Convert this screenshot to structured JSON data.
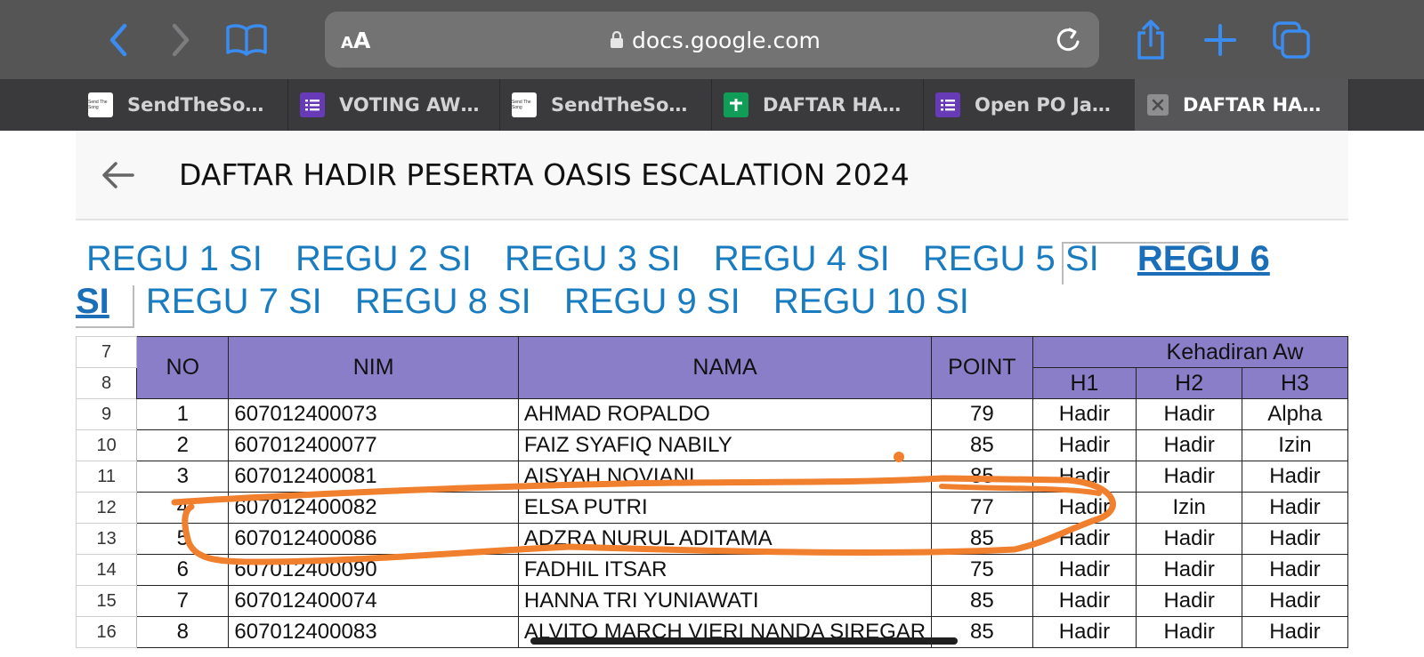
{
  "browser": {
    "url_display": "docs.google.com",
    "text_size_small": "A",
    "text_size_big": "A",
    "tabs": [
      {
        "label": "SendTheSo…",
        "favicon": "sendthesong-favicon",
        "active": false
      },
      {
        "label": "VOTING AW…",
        "favicon": "google-forms-icon",
        "active": false
      },
      {
        "label": "SendTheSo…",
        "favicon": "sendthesong-favicon",
        "active": false
      },
      {
        "label": "DAFTAR HA…",
        "favicon": "google-sheets-icon",
        "active": false
      },
      {
        "label": "Open PO Ja…",
        "favicon": "google-forms-icon",
        "active": false
      },
      {
        "label": "DAFTAR HA…",
        "favicon": "close-tab-icon",
        "active": true
      }
    ],
    "favicon_text": "Send The Song",
    "colors": {
      "accent": "#3b82f6",
      "forms": "#673ab7",
      "sheets": "#0f9d58"
    }
  },
  "doc": {
    "title": "DAFTAR HADIR PESERTA OASIS ESCALATION 2024",
    "sheet_tabs": [
      "REGU 1 SI",
      "REGU 2 SI",
      "REGU 3 SI",
      "REGU 4 SI",
      "REGU 5 SI",
      "REGU 6 SI",
      "REGU 7 SI",
      "REGU 8 SI",
      "REGU 9 SI",
      "REGU 10 SI"
    ],
    "active_tab": "REGU 6 SI",
    "active_tab_part1": "REGU 6",
    "active_tab_part2": "SI"
  },
  "sheet": {
    "header_color": "#8b7ec8",
    "row_numbers": [
      "7",
      "8",
      "9",
      "10",
      "11",
      "12",
      "13",
      "14",
      "15",
      "16"
    ],
    "headers": {
      "no": "NO",
      "nim": "NIM",
      "nama": "NAMA",
      "point": "POINT",
      "kehadiran": "Kehadiran Aw",
      "h1": "H1",
      "h2": "H2",
      "h3": "H3"
    },
    "rows": [
      {
        "row": "9",
        "no": "1",
        "nim": "607012400073",
        "nama": "AHMAD ROPALDO",
        "point": "79",
        "h1": "Hadir",
        "h2": "Hadir",
        "h3": "Alpha"
      },
      {
        "row": "10",
        "no": "2",
        "nim": "607012400077",
        "nama": "FAIZ SYAFIQ NABILY",
        "point": "85",
        "h1": "Hadir",
        "h2": "Hadir",
        "h3": "Izin"
      },
      {
        "row": "11",
        "no": "3",
        "nim": "607012400081",
        "nama": "AISYAH NOVIANI",
        "point": "85",
        "h1": "Hadir",
        "h2": "Hadir",
        "h3": "Hadir"
      },
      {
        "row": "12",
        "no": "4",
        "nim": "607012400082",
        "nama": "ELSA PUTRI",
        "point": "77",
        "h1": "Hadir",
        "h2": "Izin",
        "h3": "Hadir"
      },
      {
        "row": "13",
        "no": "5",
        "nim": "607012400086",
        "nama": "ADZRA NURUL ADITAMA",
        "point": "85",
        "h1": "Hadir",
        "h2": "Hadir",
        "h3": "Hadir"
      },
      {
        "row": "14",
        "no": "6",
        "nim": "607012400090",
        "nama": "FADHIL ITSAR",
        "point": "75",
        "h1": "Hadir",
        "h2": "Hadir",
        "h3": "Hadir"
      },
      {
        "row": "15",
        "no": "7",
        "nim": "607012400074",
        "nama": "HANNA TRI YUNIAWATI",
        "point": "85",
        "h1": "Hadir",
        "h2": "Hadir",
        "h3": "Hadir"
      },
      {
        "row": "16",
        "no": "8",
        "nim": "607012400083",
        "nama": "ALVITO MARCH VIERI NANDA SIREGAR",
        "point": "85",
        "h1": "Hadir",
        "h2": "Hadir",
        "h3": "Hadir"
      }
    ]
  },
  "annotation": {
    "color": "#f07f2e"
  }
}
